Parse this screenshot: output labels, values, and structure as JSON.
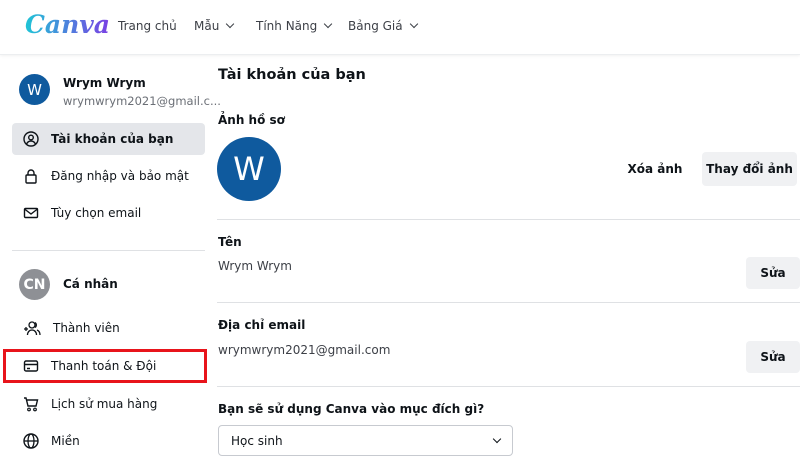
{
  "header": {
    "logo": "Canva",
    "nav": [
      "Trang chủ",
      "Mẫu",
      "Tính Năng",
      "Bảng Giá"
    ]
  },
  "sidebar": {
    "user": {
      "initial": "W",
      "name": "Wrym Wrym",
      "email": "wrymwrym2021@gmail.c..."
    },
    "account_items": [
      {
        "label": "Tài khoản của bạn",
        "icon": "user-circle-icon"
      },
      {
        "label": "Đăng nhập và bảo mật",
        "icon": "lock-icon"
      },
      {
        "label": "Tùy chọn email",
        "icon": "mail-icon"
      }
    ],
    "team": {
      "initial": "CN",
      "name": "Cá nhân"
    },
    "team_items": [
      {
        "label": "Thành viên",
        "icon": "add-people-icon"
      },
      {
        "label": "Thanh toán & Đội",
        "icon": "credit-card-icon"
      },
      {
        "label": "Lịch sử mua hàng",
        "icon": "cart-icon"
      },
      {
        "label": "Miền",
        "icon": "globe-icon"
      }
    ],
    "highlight_color": "#e8141b"
  },
  "main": {
    "title": "Tài khoản của bạn",
    "photo": {
      "label": "Ảnh hồ sơ",
      "initial": "W",
      "remove": "Xóa ảnh",
      "change": "Thay đổi ảnh"
    },
    "name": {
      "label": "Tên",
      "value": "Wrym Wrym",
      "edit": "Sửa"
    },
    "email": {
      "label": "Địa chỉ email",
      "value": "wrymwrym2021@gmail.com",
      "edit": "Sửa"
    },
    "purpose": {
      "label": "Bạn sẽ sử dụng Canva vào mục đích gì?",
      "value": "Học sinh"
    }
  }
}
